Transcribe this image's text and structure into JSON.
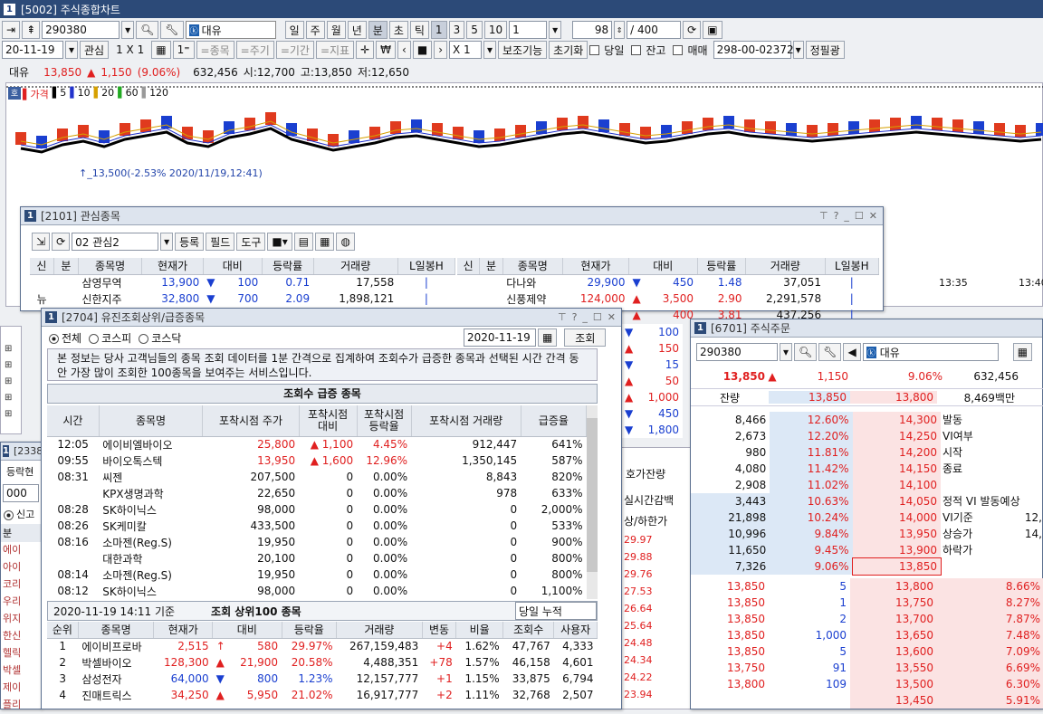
{
  "main": {
    "title": "[5002] 주식종합차트",
    "code": "290380",
    "name": "대유",
    "periods": [
      "일",
      "주",
      "월",
      "년",
      "분",
      "초",
      "틱"
    ],
    "intervals": [
      "1",
      "3",
      "5",
      "10"
    ],
    "interval_val": "1",
    "count": "98",
    "total": "/ 400",
    "date": "20-11-19",
    "watch_btn": "관심",
    "layout": "1 X 1",
    "tb": [
      "=종목",
      "=주기",
      "=기간",
      "=지표"
    ],
    "x1": "X 1",
    "aux": "보조기능",
    "reset": "초기화",
    "chk": [
      "당일",
      "잔고",
      "매매"
    ],
    "acct": "298-00-023727",
    "owner": "정필광"
  },
  "quote": {
    "name": "대유",
    "price": "13,850",
    "arrow": "▲",
    "chg": "1,150",
    "pct": "(9.06%)",
    "vol": "632,456",
    "open": "시:12,700",
    "high": "고:13,850",
    "low": "저:12,650"
  },
  "chart": {
    "ma_label": "가격",
    "ma": [
      "5",
      "10",
      "20",
      "60",
      "120"
    ],
    "ma_colors": [
      "#000000",
      "#2233cc",
      "#d6a000",
      "#22aa22",
      "#999999"
    ],
    "annotation": "13,500(-2.53% 2020/11/19,12:41)",
    "times": [
      "13:35",
      "13:40"
    ]
  },
  "w2101": {
    "title": "[2101] 관심종목",
    "group": "02 관심2",
    "buttons": [
      "등록",
      "필드",
      "도구"
    ],
    "headers": [
      "신",
      "분",
      "종목명",
      "현재가",
      "대비",
      "등락률",
      "거래량",
      "L일봉H"
    ],
    "left": [
      [
        "",
        "",
        "삼영무역",
        "13,900",
        "▼",
        "100",
        "0.71",
        "17,558"
      ],
      [
        "뉴",
        "",
        "신한지주",
        "32,800",
        "▼",
        "700",
        "2.09",
        "1,898,121"
      ]
    ],
    "right": [
      [
        "",
        "",
        "다나와",
        "29,900",
        "▼",
        "450",
        "1.48",
        "37,051"
      ],
      [
        "",
        "",
        "신풍제약",
        "124,000",
        "▲",
        "3,500",
        "2.90",
        "2,291,578"
      ],
      [
        "",
        "",
        "",
        "",
        "▲",
        "400",
        "3.81",
        "437,256"
      ]
    ],
    "right_extra": [
      [
        "▼",
        "100"
      ],
      [
        "▲",
        "150"
      ],
      [
        "▼",
        "15"
      ],
      [
        "▲",
        "50"
      ],
      [
        "▲",
        "1,000"
      ],
      [
        "▼",
        "450"
      ],
      [
        "▼",
        "1,800"
      ]
    ]
  },
  "w2704": {
    "title": "[2704] 유진조회상위/급증종목",
    "radios": [
      "전체",
      "코스피",
      "코스닥"
    ],
    "date": "2020-11-19",
    "query": "조회",
    "notice": "본 정보는 당사 고객님들의 종목 조회 데이터를 1분 간격으로 집계하여 조회수가 급증한 종목과 선택된 시간 간격 동안 가장 많이 조회한 100종목을 보여주는 서비스입니다.",
    "surge_title": "조회수 급증 종목",
    "surge_headers": [
      "시간",
      "종목명",
      "포착시점 주가",
      "포착시점 대비",
      "포착시점 등락율",
      "포착시점 거래량",
      "급증율"
    ],
    "surge": [
      [
        "12:05",
        "에이비엘바이오",
        "25,800",
        "▲",
        "1,100",
        "4.45%",
        "912,447",
        "641%"
      ],
      [
        "09:55",
        "바이오톡스텍",
        "13,950",
        "▲",
        "1,600",
        "12.96%",
        "1,350,145",
        "587%"
      ],
      [
        "08:31",
        "씨젠",
        "207,500",
        "",
        "0",
        "0.00%",
        "8,843",
        "820%"
      ],
      [
        "",
        "KPX생명과학",
        "22,650",
        "",
        "0",
        "0.00%",
        "978",
        "633%"
      ],
      [
        "08:28",
        "SK하이닉스",
        "98,000",
        "",
        "0",
        "0.00%",
        "0",
        "2,000%"
      ],
      [
        "08:26",
        "SK케미칼",
        "433,500",
        "",
        "0",
        "0.00%",
        "0",
        "533%"
      ],
      [
        "08:16",
        "소마젠(Reg.S)",
        "19,950",
        "",
        "0",
        "0.00%",
        "0",
        "900%"
      ],
      [
        "",
        "대한과학",
        "20,100",
        "",
        "0",
        "0.00%",
        "0",
        "800%"
      ],
      [
        "08:14",
        "소마젠(Reg.S)",
        "19,950",
        "",
        "0",
        "0.00%",
        "0",
        "800%"
      ],
      [
        "08:12",
        "SK하이닉스",
        "98,000",
        "",
        "0",
        "0.00%",
        "0",
        "1,100%"
      ]
    ],
    "base": "2020-11-19  14:11 기준",
    "top_title": "조회 상위100 종목",
    "top_sel": "당일 누적",
    "top_headers": [
      "순위",
      "종목명",
      "현재가",
      "대비",
      "등락율",
      "거래량",
      "변동",
      "비율",
      "조회수",
      "사용자"
    ],
    "top": [
      [
        "1",
        "에이비프로바",
        "2,515",
        "↑",
        "580",
        "29.97%",
        "267,159,483",
        "+4",
        "1.62%",
        "47,767",
        "4,333"
      ],
      [
        "2",
        "박셀바이오",
        "128,300",
        "▲",
        "21,900",
        "20.58%",
        "4,488,351",
        "+78",
        "1.57%",
        "46,158",
        "4,601"
      ],
      [
        "3",
        "삼성전자",
        "64,000",
        "▼",
        "800",
        "1.23%",
        "12,157,777",
        "+1",
        "1.15%",
        "33,875",
        "6,794"
      ],
      [
        "4",
        "진매트릭스",
        "34,250",
        "▲",
        "5,950",
        "21.02%",
        "16,917,777",
        "+2",
        "1.11%",
        "32,768",
        "2,507"
      ]
    ]
  },
  "w6701": {
    "title": "[6701] 주식주문",
    "code": "290380",
    "name": "대유",
    "price": "13,850",
    "arrow": "▲",
    "chg": "1,150",
    "pct": "9.06%",
    "vol": "632,456",
    "bal_label": "잔량",
    "bal1": "13,850",
    "bal2": "13,800",
    "amt": "8,469백만",
    "asks": [
      [
        "8,466",
        "12.60%",
        "14,300"
      ],
      [
        "2,673",
        "12.20%",
        "14,250"
      ],
      [
        "980",
        "11.81%",
        "14,200"
      ],
      [
        "4,080",
        "11.42%",
        "14,150"
      ],
      [
        "2,908",
        "11.02%",
        "14,100"
      ],
      [
        "3,443",
        "10.63%",
        "14,050"
      ],
      [
        "21,898",
        "10.24%",
        "14,000"
      ],
      [
        "10,996",
        "9.84%",
        "13,950"
      ],
      [
        "11,650",
        "9.45%",
        "13,900"
      ],
      [
        "7,326",
        "9.06%",
        "13,850"
      ]
    ],
    "info": [
      "발동",
      "VI여부",
      "시작",
      "종료",
      "",
      "정적 VI 발동예상",
      "VI기준",
      "상승가",
      "하락가"
    ],
    "info_vals": [
      "",
      "",
      "",
      "",
      "",
      "",
      "12,",
      "14,",
      ""
    ],
    "fills": [
      [
        "13,850",
        "5"
      ],
      [
        "13,850",
        "1"
      ],
      [
        "13,850",
        "2"
      ],
      [
        "13,850",
        "1,000"
      ],
      [
        "13,850",
        "5"
      ],
      [
        "13,750",
        "91"
      ],
      [
        "13,800",
        "109"
      ]
    ],
    "bids": [
      [
        "13,800",
        "8.66%"
      ],
      [
        "13,750",
        "8.27%"
      ],
      [
        "13,700",
        "7.87%"
      ],
      [
        "13,650",
        "7.48%"
      ],
      [
        "13,600",
        "7.09%"
      ],
      [
        "13,550",
        "6.69%"
      ],
      [
        "13,500",
        "6.30%"
      ],
      [
        "13,450",
        "5.91%"
      ]
    ]
  },
  "w2338": {
    "title": "[2338]",
    "label": "등락현",
    "val": "000",
    "radio": "신고",
    "cols": [
      "분"
    ],
    "rows": [
      "에이",
      "아이",
      "코리",
      "우리",
      "위지",
      "한신",
      "헬릭",
      "박셀",
      "제이",
      "플리"
    ]
  },
  "mid": {
    "label1": "호가잔량",
    "label2": "실시간감백",
    "label3": "상/하한가",
    "pcts": [
      "29.97",
      "29.88",
      "29.76",
      "27.53",
      "26.64",
      "25.64",
      "24.48",
      "24.34",
      "24.22",
      "23.94"
    ]
  }
}
